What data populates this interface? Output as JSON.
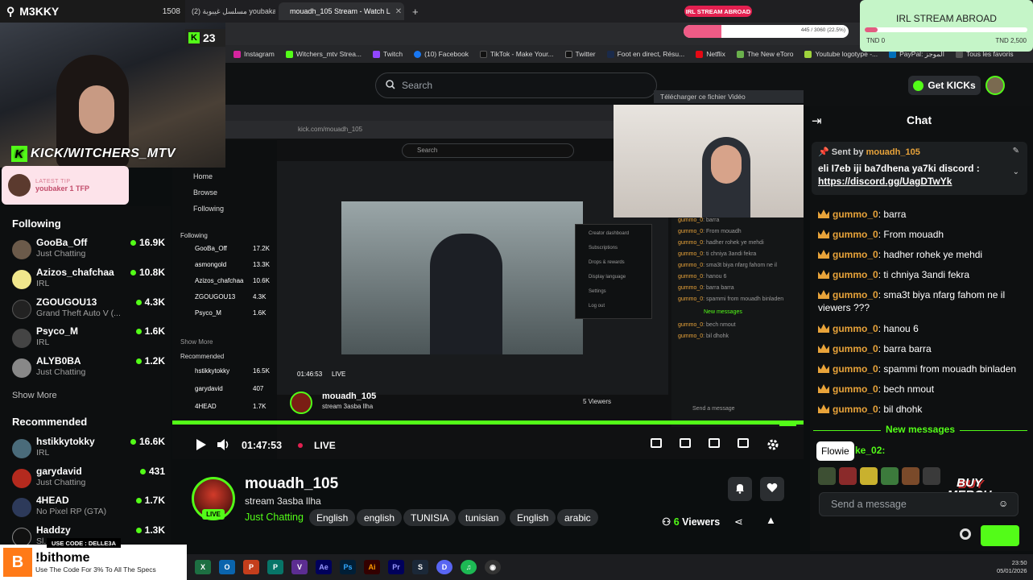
{
  "browser": {
    "tabs": [
      {
        "label": "مسلسل غيبوبة (2) youbaka",
        "active": false
      },
      {
        "label": "mouadh_105 Stream - Watch L",
        "active": true
      }
    ],
    "new_tab": "+",
    "bookmarks": [
      "Instagram",
      "Witchers_mtv Strea...",
      "Twitch",
      "(10) Facebook",
      "TikTok - Make Your...",
      "Twitter",
      "Foot en direct, Résu...",
      "Netflix",
      "The New eToro",
      "Youtube logotype -...",
      "PayPal: الموجز",
      "Tous les favoris"
    ]
  },
  "overlay": {
    "streamer": "M3KKY",
    "streamer_count": "1508",
    "kick_count": "23",
    "kick_handle": "KICK/WITCHERS_MTV",
    "latest_tip_label": "LATEST TIP",
    "latest_tip_value": "youbaker 1 TFP",
    "irl_pill": "IRL STREAM ABROAD",
    "irl_title": "IRL STREAM ABROAD",
    "irl_low": "TND 0",
    "irl_high": "TND 2,500",
    "irl_progress": 0.08,
    "goal_text": "445 / 3060 (22.5%)",
    "goal_progress": 0.23,
    "merch": "BUY MERCH NOW!"
  },
  "header": {
    "search_placeholder": "Search",
    "get_kicks": "Get KICKs"
  },
  "sidebar": {
    "following_title": "Following",
    "following": [
      {
        "name": "GooBa_Off",
        "sub": "Just Chatting",
        "viewers": "16.9K",
        "color": "#6b5a4a"
      },
      {
        "name": "Azizos_chafchaa",
        "sub": "IRL",
        "viewers": "10.8K",
        "color": "#f0e68c"
      },
      {
        "name": "ZGOUGOU13",
        "sub": "Grand Theft Auto V (...",
        "viewers": "4.3K",
        "color": "#222222"
      },
      {
        "name": "Psyco_M",
        "sub": "IRL",
        "viewers": "1.6K",
        "color": "#444444"
      },
      {
        "name": "ALYB0BA",
        "sub": "Just Chatting",
        "viewers": "1.2K",
        "color": "#888888"
      }
    ],
    "show_more_1": "Show More",
    "recommended_title": "Recommended",
    "recommended": [
      {
        "name": "hstikkytokky",
        "sub": "IRL",
        "viewers": "16.6K",
        "color": "#4a6b7a"
      },
      {
        "name": "garydavid",
        "sub": "Just Chatting",
        "viewers": "431",
        "color": "#b42a1e"
      },
      {
        "name": "4HEAD",
        "sub": "No Pixel RP (GTA)",
        "viewers": "1.7K",
        "color": "#2d3a5a"
      },
      {
        "name": "Haddzy",
        "sub": "Sl...",
        "viewers": "1.3K",
        "color": "#111111"
      }
    ]
  },
  "ad": {
    "code_label": "USE CODE : DELLE3A",
    "logo": "B",
    "headline": "!bithome",
    "subline": "Use The Code For 3% To All The Specs"
  },
  "inner": {
    "download_label": "Télécharger ce fichier Vidéo",
    "url": "kick.com/mouadh_105",
    "search": "Search",
    "nav": [
      "Home",
      "Browse",
      "Following"
    ],
    "following_title": "Following",
    "following": [
      {
        "name": "GooBa_Off",
        "v": "17.2K"
      },
      {
        "name": "asmongold",
        "v": "13.3K"
      },
      {
        "name": "Azizos_chafchaa",
        "v": "10.6K"
      },
      {
        "name": "ZGOUGOU13",
        "v": "4.3K"
      },
      {
        "name": "Psyco_M",
        "v": "1.6K"
      }
    ],
    "show_more": "Show More",
    "recommended_title": "Recommended",
    "recommended": [
      {
        "name": "hstikkytokky",
        "v": "16.5K"
      },
      {
        "name": "garydavid",
        "v": "407"
      },
      {
        "name": "4HEAD",
        "v": "1.7K"
      }
    ],
    "time": "01:46:53",
    "live": "LIVE",
    "channel": "mouadh_105",
    "title": "stream 3asba llha",
    "viewers": "5 Viewers",
    "send_message": "Send a message",
    "chat_btn": "Chat",
    "new_messages": "New messages",
    "chat_lines": [
      {
        "user": "gummo_0",
        "text": "barra"
      },
      {
        "user": "gummo_0",
        "text": "From mouadh"
      },
      {
        "user": "gummo_0",
        "text": "hadher rohek ye mehdi"
      },
      {
        "user": "gummo_0",
        "text": "ti chniya 3andi fekra"
      },
      {
        "user": "gummo_0",
        "text": "sma3t biya nfarg fahom ne il"
      },
      {
        "user": "gummo_0",
        "text": "hanou 6"
      },
      {
        "user": "gummo_0",
        "text": "barra barra"
      },
      {
        "user": "gummo_0",
        "text": "spammi from mouadh binladen"
      },
      {
        "user": "gummo_0",
        "text": "bech nmout"
      },
      {
        "user": "gummo_0",
        "text": "bil dhohk"
      }
    ],
    "menu": [
      "Creator dashboard",
      "Subscriptions",
      "Drops & rewards",
      "Display language",
      "Settings",
      "Log out"
    ]
  },
  "player": {
    "time": "01:47:53",
    "live": "LIVE"
  },
  "channel": {
    "live_badge": "LIVE",
    "name": "mouadh_105",
    "title": "stream 3asba llha",
    "category": "Just Chatting",
    "tags": [
      "English",
      "english",
      "TUNISIA",
      "tunisian",
      "English",
      "arabic"
    ],
    "viewers_count": "6",
    "viewers_label": "Viewers"
  },
  "chat": {
    "title": "Chat",
    "pinned_by_label": "Sent by",
    "pinned_by": "mouadh_105",
    "pinned_text": "eli I7eb iji ba7dhena ya7ki discord :",
    "pinned_link": "https://discord.gg/UagDTwYk",
    "messages": [
      {
        "user": "gummo_0",
        "text": "barra"
      },
      {
        "user": "gummo_0",
        "text": "From mouadh"
      },
      {
        "user": "gummo_0",
        "text": "hadher rohek ye mehdi"
      },
      {
        "user": "gummo_0",
        "text": "ti chniya 3andi fekra"
      },
      {
        "user": "gummo_0",
        "text": "sma3t biya nfarg fahom ne il viewers ???"
      },
      {
        "user": "gummo_0",
        "text": "hanou 6"
      },
      {
        "user": "gummo_0",
        "text": "barra barra"
      },
      {
        "user": "gummo_0",
        "text": "spammi from mouadh binladen"
      },
      {
        "user": "gummo_0",
        "text": "bech nmout"
      },
      {
        "user": "gummo_0",
        "text": "bil dhohk"
      }
    ],
    "new_messages": "New messages",
    "tooltip": "Flowie",
    "partial_user": "ke_02:",
    "send_placeholder": "Send a message"
  },
  "taskbar": {
    "clock_time": "23:50",
    "clock_date": "05/01/2026"
  }
}
